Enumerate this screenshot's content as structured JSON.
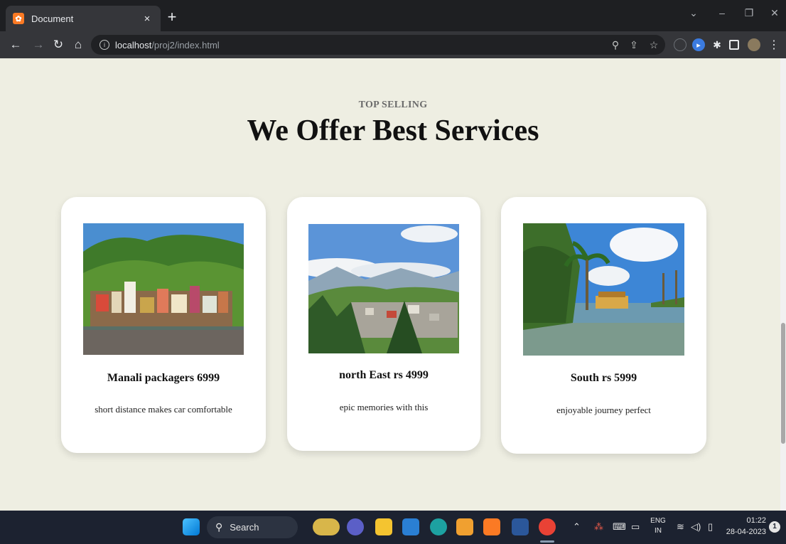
{
  "browser": {
    "tab_title": "Document",
    "tab_close": "×",
    "new_tab": "+",
    "url_host": "localhost",
    "url_path": "/proj2/index.html",
    "window_controls": {
      "minimize": "–",
      "restore": "❐",
      "close": "✕"
    },
    "toolbar_icons": [
      "back-icon",
      "forward-icon",
      "reload-icon",
      "home-icon",
      "site-info-icon",
      "zoom-icon",
      "share-icon",
      "bookmark-star-icon",
      "extension-icon",
      "profile-avatar-icon",
      "more-menu-icon"
    ]
  },
  "section": {
    "eyebrow": "TOP SELLING",
    "heading": "We Offer Best Services"
  },
  "cards": [
    {
      "title": "Manali packagers 6999",
      "description": "short distance makes car comfortable",
      "image": "manali-hill-town-photo"
    },
    {
      "title": "north East rs 4999",
      "description": "epic memories with this",
      "image": "north-east-mountain-town-photo"
    },
    {
      "title": "South rs 5999",
      "description": "enjoyable journey perfect",
      "image": "kerala-backwater-houseboat-photo"
    }
  ],
  "taskbar": {
    "search_label": "Search",
    "language": "ENG",
    "region": "IN",
    "time": "01:22",
    "date": "28-04-2023",
    "notification_count": "1",
    "colors": {
      "bar": "#1c2230",
      "chrome_dark": "#35363a"
    }
  }
}
